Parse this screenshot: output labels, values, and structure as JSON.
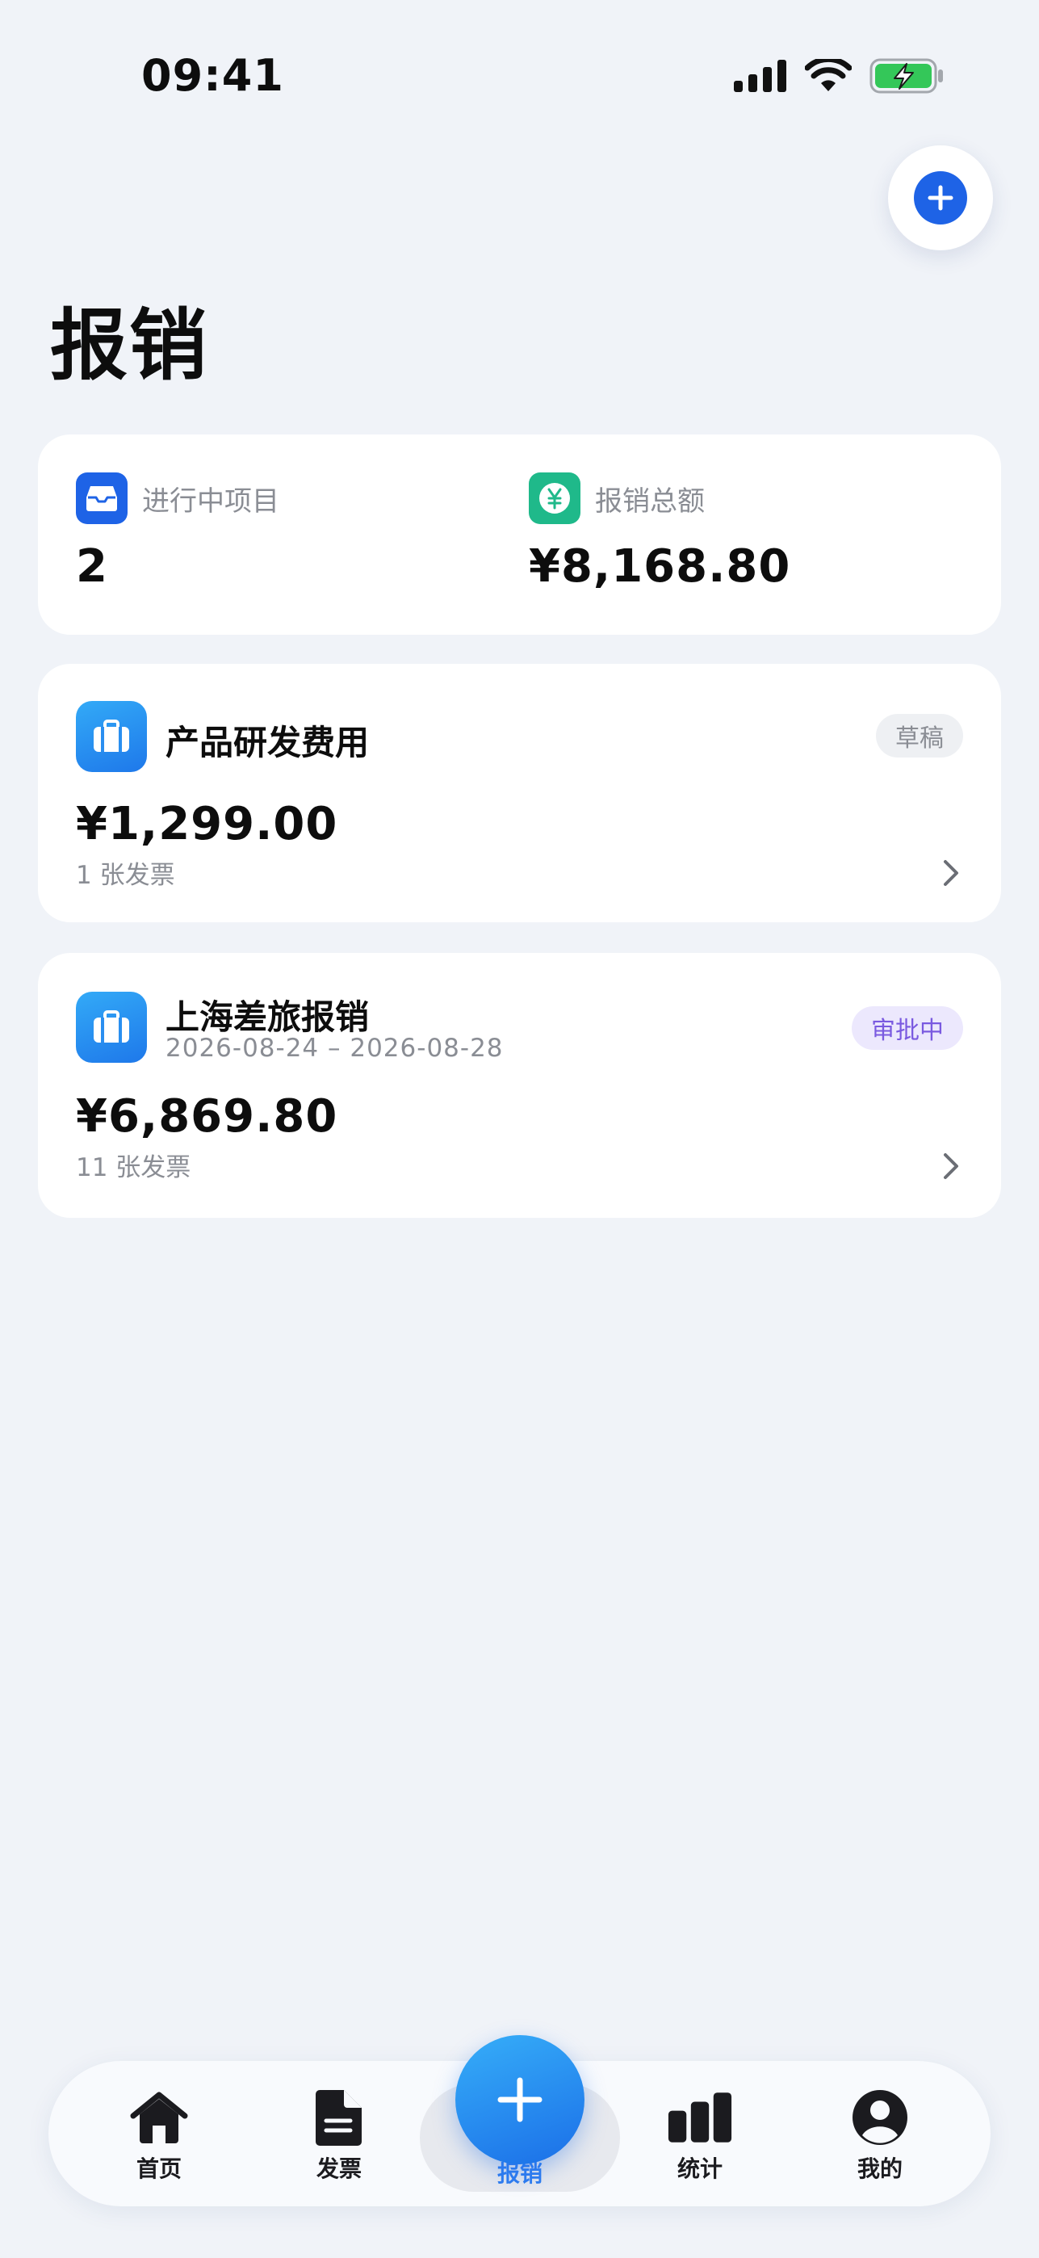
{
  "status_bar": {
    "time": "09:41"
  },
  "header": {
    "title": "报销"
  },
  "summary": {
    "in_progress": {
      "label": "进行中项目",
      "value": "2",
      "icon": "inbox-tray-icon",
      "color": "#1e63e6"
    },
    "total": {
      "label": "报销总额",
      "value": "¥8,168.80",
      "icon": "yen-coin-icon",
      "color": "#1fb98a"
    }
  },
  "projects": [
    {
      "name": "产品研发费用",
      "dates": "",
      "status": "草稿",
      "amount": "¥1,299.00",
      "invoice_count": "1 张发票",
      "icon": "briefcase-icon"
    },
    {
      "name": "上海差旅报销",
      "dates": "2026-08-24 – 2026-08-28",
      "status": "审批中",
      "amount": "¥6,869.80",
      "invoice_count": "11 张发票",
      "icon": "briefcase-icon"
    }
  ],
  "tab_bar": {
    "items": [
      {
        "label": "首页",
        "icon": "house-icon"
      },
      {
        "label": "发票",
        "icon": "document-icon"
      },
      {
        "label": "报销",
        "icon": "plus-icon",
        "active": true
      },
      {
        "label": "统计",
        "icon": "bar-chart-icon"
      },
      {
        "label": "我的",
        "icon": "person-icon"
      }
    ]
  },
  "colors": {
    "accent": "#1e63e6",
    "background": "#f0f3f8",
    "badge_review_text": "#7a5ae0",
    "battery_green": "#34c759"
  }
}
